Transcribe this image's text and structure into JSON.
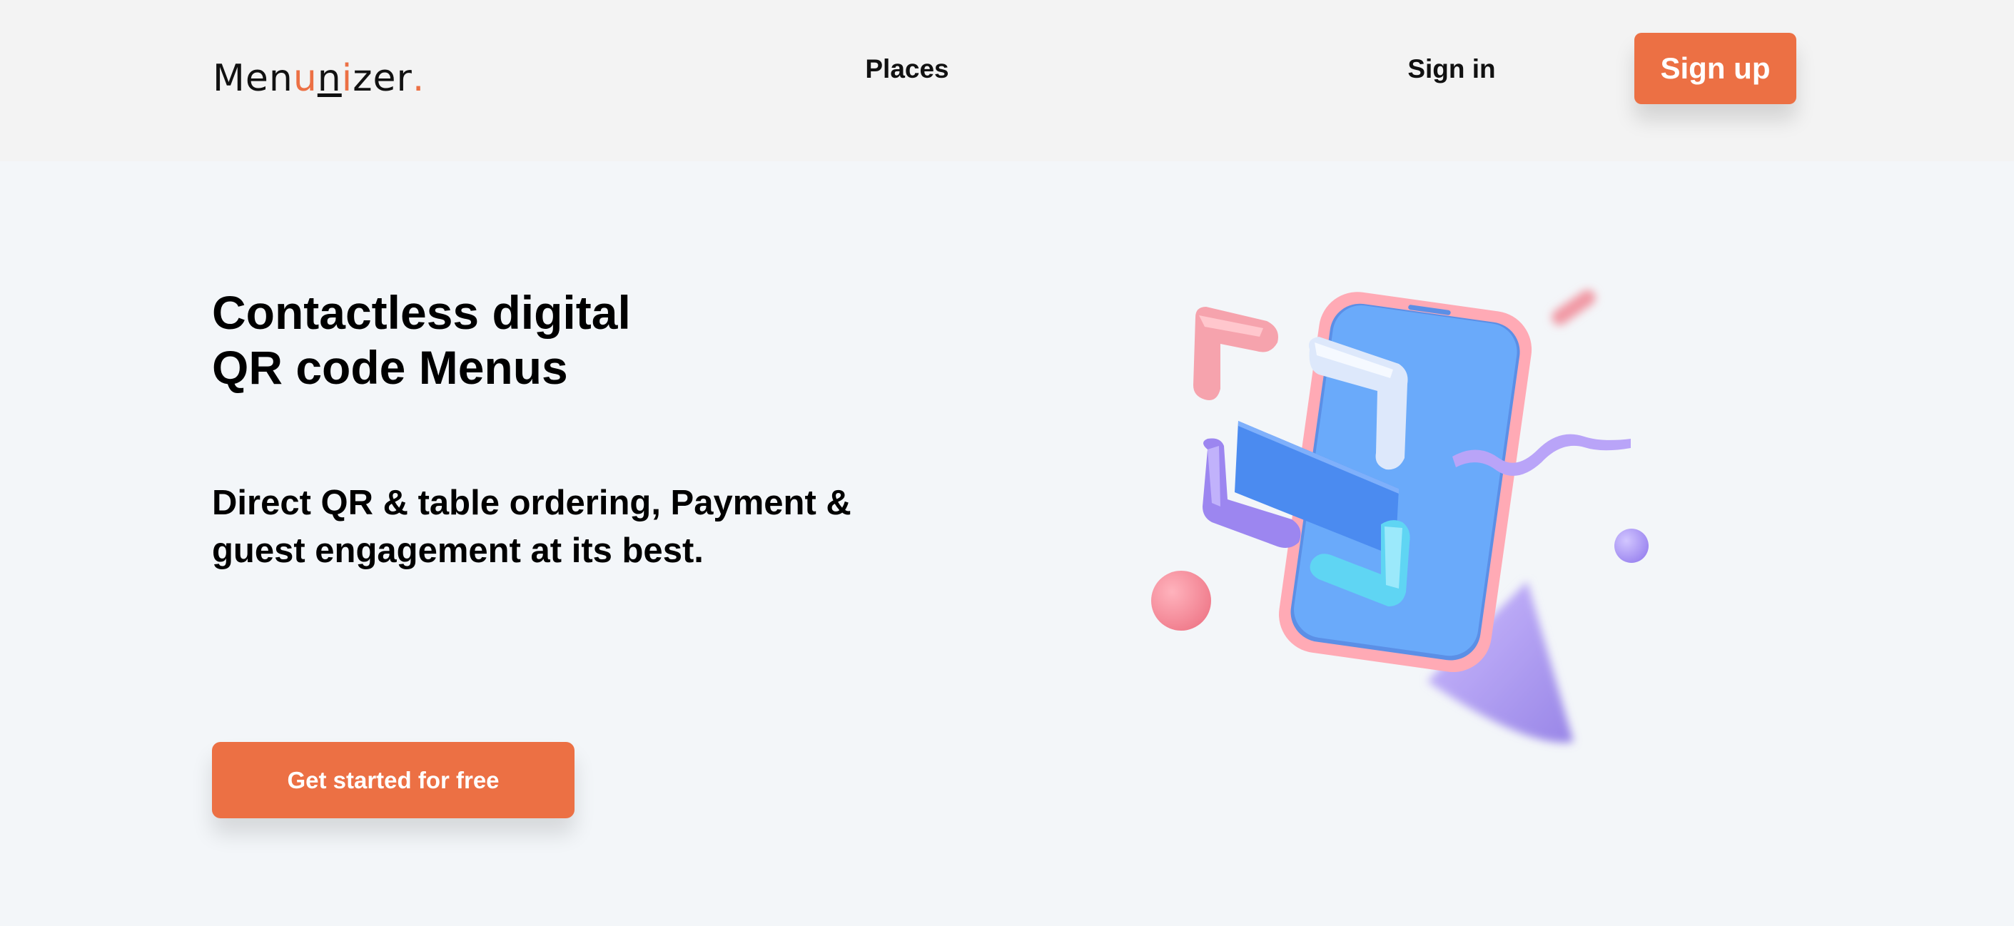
{
  "brand": {
    "name_prefix": "Men",
    "name_u": "u",
    "name_n": "n",
    "name_i": "i",
    "name_suffix": "zer",
    "name_dot": ".",
    "accent_color": "#ec7044"
  },
  "nav": {
    "places_label": "Places",
    "signin_label": "Sign in",
    "signup_label": "Sign up"
  },
  "hero": {
    "title_line1": "Contactless digital",
    "title_line2": "QR code Menus",
    "subtitle_line1": "Direct QR & table ordering, Payment &",
    "subtitle_line2": "guest engagement at its best.",
    "cta_label": "Get started for free"
  },
  "illustration": {
    "icon": "phone-with-qr-shapes-illustration"
  }
}
